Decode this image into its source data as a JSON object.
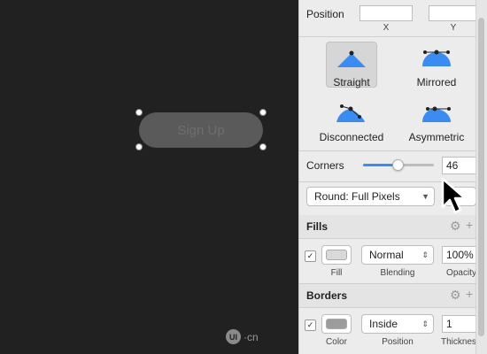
{
  "canvas": {
    "button_text": "Sign Up",
    "watermark": {
      "logo": "UI",
      "text": "·cn"
    }
  },
  "position": {
    "label": "Position",
    "x_label": "X",
    "y_label": "Y",
    "x_value": "",
    "y_value": ""
  },
  "point_types": [
    {
      "label": "Straight",
      "icon": "straight-point-icon",
      "selected": true
    },
    {
      "label": "Mirrored",
      "icon": "mirrored-point-icon",
      "selected": false
    },
    {
      "label": "Disconnected",
      "icon": "disconnected-point-icon",
      "selected": false
    },
    {
      "label": "Asymmetric",
      "icon": "asymmetric-point-icon",
      "selected": false
    }
  ],
  "corners": {
    "label": "Corners",
    "value": "46",
    "slider_level": 0.47
  },
  "rounding": {
    "selected": "Round: Full Pixels"
  },
  "fills": {
    "title": "Fills",
    "fill_label": "Fill",
    "blending_label": "Blending",
    "blending_value": "Normal",
    "opacity_label": "Opacity",
    "opacity_value": "100%",
    "checked": true,
    "swatch_color": "#d9d9d9"
  },
  "borders": {
    "title": "Borders",
    "color_label": "Color",
    "position_label": "Position",
    "position_value": "Inside",
    "thickness_label": "Thickness",
    "thickness_value": "1",
    "checked": true,
    "swatch_color": "#9c9c9c"
  },
  "colors": {
    "accent": "#3b8cf0",
    "canvas_bg": "#212121",
    "inspector_bg": "#ececec"
  }
}
